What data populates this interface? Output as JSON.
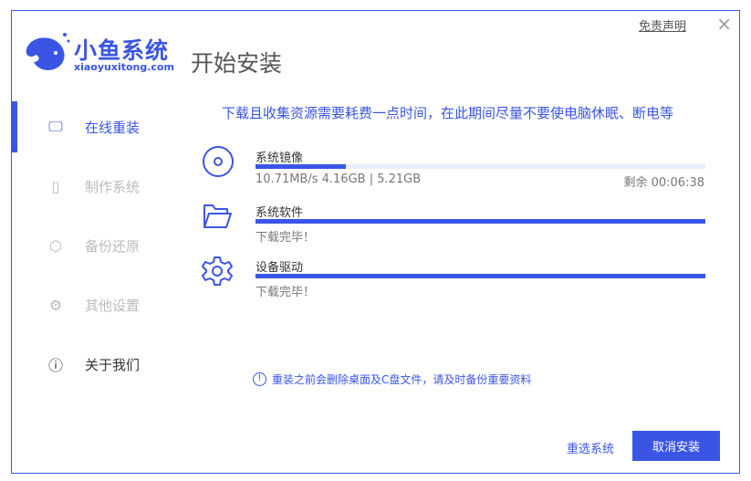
{
  "logo": {
    "name": "小鱼系统",
    "domain": "xiaoyuxitong.com"
  },
  "title": "开始安装",
  "header": {
    "disclaimer": "免责声明",
    "close": "×"
  },
  "sidebar": {
    "items": [
      {
        "label": "在线重装",
        "icon": "monitor-icon",
        "active": true
      },
      {
        "label": "制作系统",
        "icon": "usb-icon"
      },
      {
        "label": "备份还原",
        "icon": "backup-icon"
      },
      {
        "label": "其他设置",
        "icon": "gear-icon"
      },
      {
        "label": "关于我们",
        "icon": "info-icon"
      }
    ]
  },
  "notice": "下载且收集资源需要耗费一点时间，在此期间尽量不要使电脑休眠、断电等",
  "downloads": [
    {
      "label": "系统镜像",
      "progress": 0.2,
      "stats": "10.71MB/s 4.16GB | 5.21GB",
      "remaining": "剩余 00:06:38"
    },
    {
      "label": "系统软件",
      "progress": 1.0,
      "status": "下载完毕！"
    },
    {
      "label": "设备驱动",
      "progress": 1.0,
      "status": "下载完毕！"
    }
  ],
  "warning": "重装之前会删除桌面及C盘文件，请及时备份重要资料",
  "buttons": {
    "reselect": "重选系统",
    "cancel": "取消安装"
  },
  "colors": {
    "accent": "#3a55e6"
  }
}
